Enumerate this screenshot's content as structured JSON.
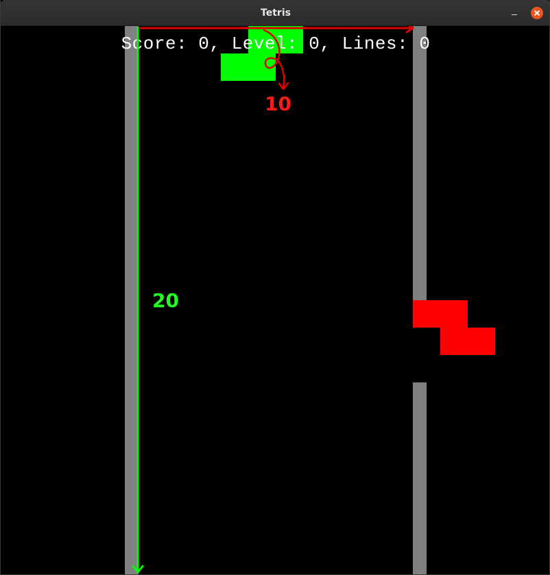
{
  "window": {
    "title": "Tetris"
  },
  "hud": {
    "text": "Score: 0, Level: 0, Lines: 0",
    "score": 0,
    "level": 0,
    "lines": 0
  },
  "board": {
    "columns_annotation": "10",
    "rows_annotation": "20"
  },
  "pieces": {
    "current": {
      "shape": "S",
      "color": "#00ff00"
    },
    "next": {
      "shape": "Z",
      "color": "#ff0000"
    }
  },
  "colors": {
    "wall": "#808080",
    "background": "#000000",
    "width_arrow": "#ff0000",
    "height_arrow": "#00ff00",
    "close_button": "#e95420"
  },
  "icons": {
    "minimize": "minimize-icon",
    "close": "close-icon"
  }
}
